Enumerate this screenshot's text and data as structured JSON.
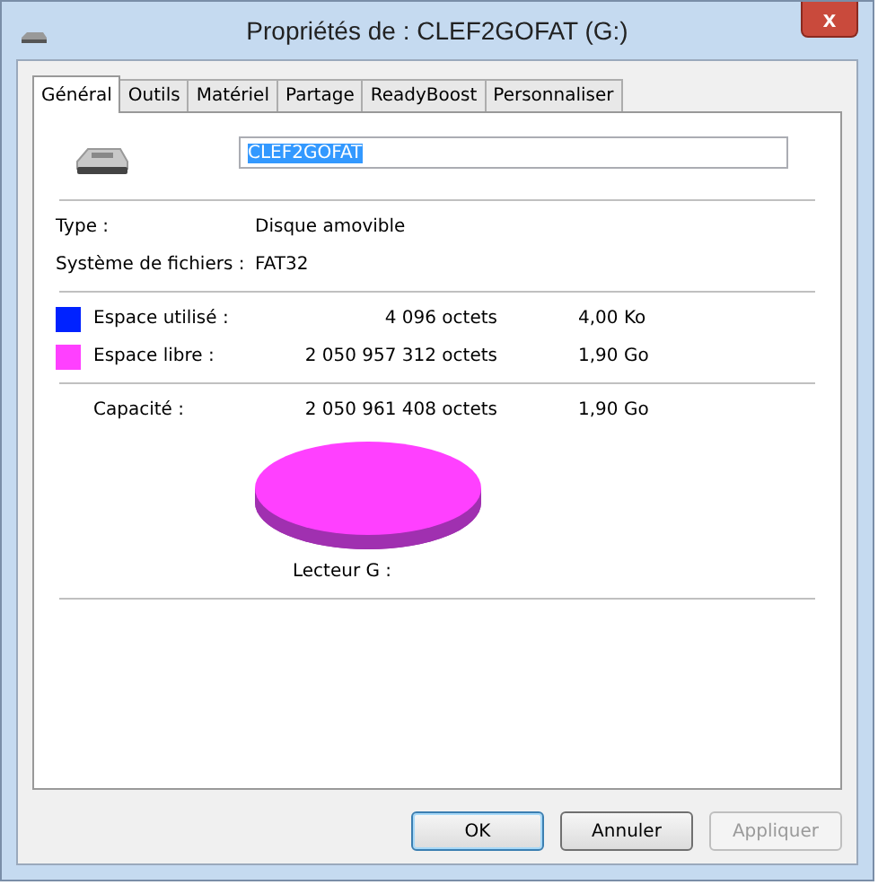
{
  "window": {
    "title": "Propriétés de : CLEF2GOFAT (G:)",
    "close": "x"
  },
  "tabs": [
    {
      "label": "Général",
      "selected": true
    },
    {
      "label": "Outils",
      "selected": false
    },
    {
      "label": "Matériel",
      "selected": false
    },
    {
      "label": "Partage",
      "selected": false
    },
    {
      "label": "ReadyBoost",
      "selected": false
    },
    {
      "label": "Personnaliser",
      "selected": false
    }
  ],
  "name_field": {
    "value": "CLEF2GOFAT",
    "selected": true
  },
  "info": [
    {
      "label": "Type :",
      "value": "Disque amovible"
    },
    {
      "label": "Système de fichiers :",
      "value": "FAT32"
    }
  ],
  "space": [
    {
      "color": "#0022ff",
      "label": "Espace utilisé :",
      "bytes": "4 096 octets",
      "size": "4,00 Ko"
    },
    {
      "color": "#ff40ff",
      "label": "Espace libre :",
      "bytes": "2 050 957 312 octets",
      "size": "1,90 Go"
    }
  ],
  "capacity": {
    "label": "Capacité :",
    "bytes": "2 050 961 408 octets",
    "size": "1,90 Go"
  },
  "drive_label": "Lecteur G :",
  "buttons": [
    {
      "label": "OK",
      "kind": "default",
      "disabled": false
    },
    {
      "label": "Annuler",
      "kind": "normal",
      "disabled": false
    },
    {
      "label": "Appliquer",
      "kind": "normal",
      "disabled": true
    }
  ]
}
